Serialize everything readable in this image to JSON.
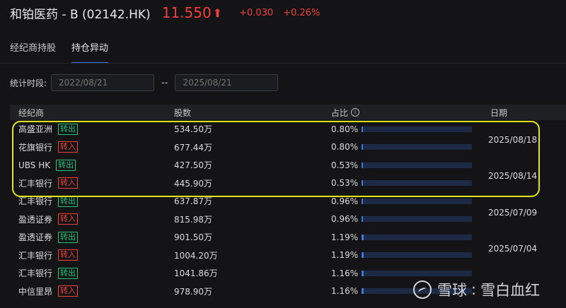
{
  "header": {
    "stock_name": "和铂医药 - B (02142.HK)",
    "price": "11.550",
    "change": "+0.030",
    "change_pct": "+0.26%"
  },
  "tabs": [
    {
      "label": "经纪商持股",
      "active": false
    },
    {
      "label": "持仓异动",
      "active": true
    }
  ],
  "period": {
    "label": "统计时段:",
    "start": "2022/08/21",
    "separator": "--",
    "end": "2025/08/21"
  },
  "table": {
    "columns": [
      "经纪商",
      "股数",
      "占比",
      "日期"
    ],
    "rows": [
      {
        "broker": "高盛亚洲",
        "action": "转出",
        "type": "out",
        "shares": "534.50万",
        "pct": "0.80%",
        "pct_value": 0.8
      },
      {
        "broker": "花旗银行",
        "action": "转入",
        "type": "in",
        "shares": "677.44万",
        "pct": "0.80%",
        "pct_value": 0.8
      },
      {
        "broker": "UBS HK",
        "action": "转出",
        "type": "out",
        "shares": "427.50万",
        "pct": "0.53%",
        "pct_value": 0.53
      },
      {
        "broker": "汇丰银行",
        "action": "转入",
        "type": "in",
        "shares": "445.90万",
        "pct": "0.53%",
        "pct_value": 0.53
      },
      {
        "broker": "汇丰银行",
        "action": "转出",
        "type": "out",
        "shares": "637.87万",
        "pct": "0.96%",
        "pct_value": 0.96
      },
      {
        "broker": "盈透证券",
        "action": "转入",
        "type": "in",
        "shares": "815.98万",
        "pct": "0.96%",
        "pct_value": 0.96
      },
      {
        "broker": "盈透证券",
        "action": "转出",
        "type": "out",
        "shares": "901.50万",
        "pct": "1.19%",
        "pct_value": 1.19
      },
      {
        "broker": "汇丰银行",
        "action": "转入",
        "type": "in",
        "shares": "1004.20万",
        "pct": "1.19%",
        "pct_value": 1.19
      },
      {
        "broker": "汇丰银行",
        "action": "转出",
        "type": "out",
        "shares": "1041.86万",
        "pct": "1.16%",
        "pct_value": 1.16
      },
      {
        "broker": "中信里昂",
        "action": "转入",
        "type": "in",
        "shares": "978.90万",
        "pct": "1.16%",
        "pct_value": 1.16
      }
    ],
    "dates": [
      "2025/08/18",
      "2025/08/14",
      "2025/07/09",
      "2025/07/04"
    ]
  },
  "watermark": {
    "brand": "雪球",
    "separator": ":",
    "author": "雪白血红"
  },
  "colors": {
    "up": "#f0413c",
    "transfer_out": "#27c67a",
    "transfer_in": "#f0413c",
    "accent": "#3a76e8",
    "highlight": "#e4e41a",
    "bar": "#3e78e0"
  }
}
